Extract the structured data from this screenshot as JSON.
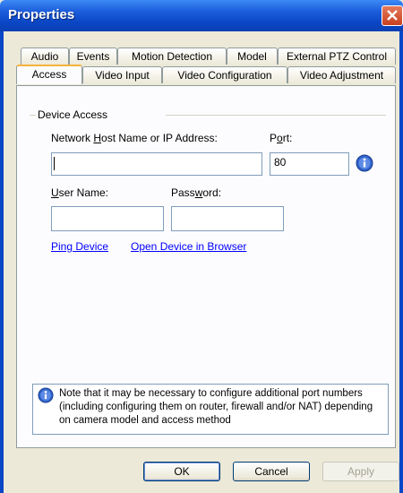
{
  "window": {
    "title": "Properties",
    "close_icon": "close-icon",
    "accent_color": "#0a47c6"
  },
  "tabs": {
    "row1": [
      "Audio",
      "Events",
      "Motion Detection",
      "Model",
      "External PTZ Control"
    ],
    "row2": [
      "Access",
      "Video Input",
      "Video Configuration",
      "Video Adjustment"
    ],
    "active": "Access"
  },
  "device_access": {
    "group_label": "Device Access",
    "host_label_prefix": "Network ",
    "host_label_u": "H",
    "host_label_suffix": "ost Name or IP Address:",
    "host_value": "",
    "port_label_prefix": "P",
    "port_label_u": "o",
    "port_label_suffix": "rt:",
    "port_value": "80",
    "info_icon": "info-icon",
    "user_label_u": "U",
    "user_label_suffix": "ser Name:",
    "user_value": "",
    "password_label_prefix": "Pass",
    "password_label_u": "w",
    "password_label_suffix": "ord:",
    "password_value": "",
    "ping_link": "Ping Device",
    "open_link": "Open Device in Browser"
  },
  "note": {
    "icon": "info-icon",
    "text": "Note that it may be necessary to configure additional port numbers (including configuring them on router, firewall and/or NAT) depending on camera model and access method"
  },
  "buttons": {
    "ok": "OK",
    "cancel": "Cancel",
    "apply": "Apply"
  }
}
